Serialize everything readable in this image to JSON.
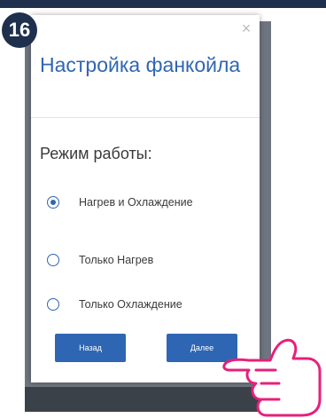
{
  "step_number": "16",
  "dialog": {
    "title": "Настройка фанкойла",
    "close_symbol": "×",
    "section_label": "Режим работы:",
    "options": [
      {
        "label": "Нагрев и Охлаждение",
        "selected": true
      },
      {
        "label": "Только Нагрев",
        "selected": false
      },
      {
        "label": "Только Охлаждение",
        "selected": false
      }
    ],
    "back_label": "Назад",
    "next_label": "Далее"
  },
  "colors": {
    "accent": "#2f66b3",
    "badge": "#1f2f4e",
    "pointer": "#e6207c"
  },
  "icons": {
    "pointer": "hand-pointer-icon",
    "close": "close-icon"
  }
}
